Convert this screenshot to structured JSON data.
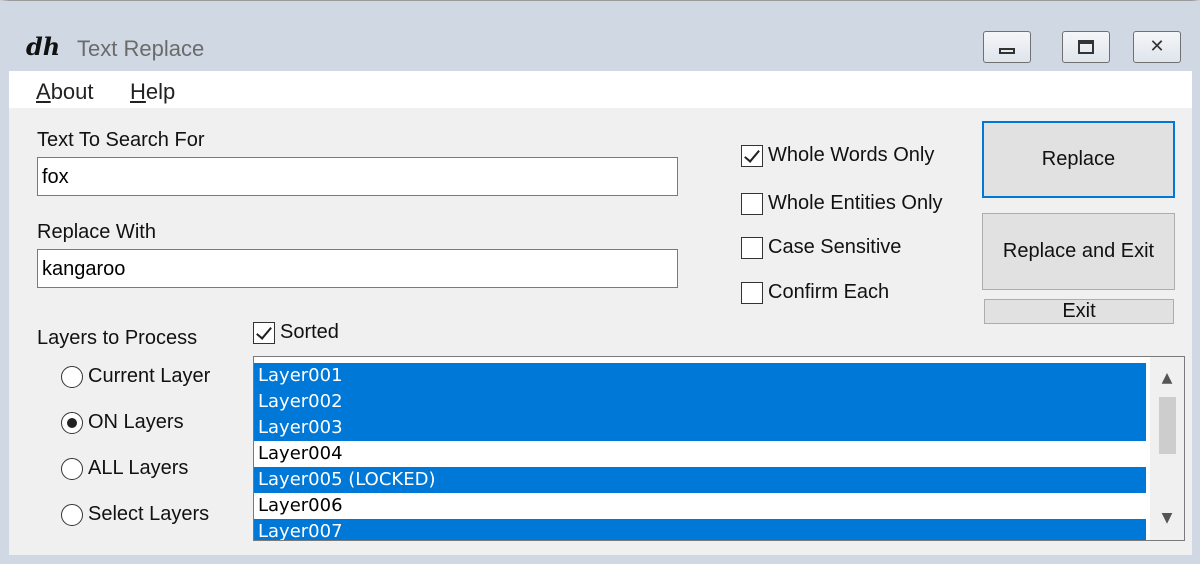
{
  "window": {
    "logo": "dh",
    "title": "Text Replace",
    "controls": {
      "minimize_icon": "minimize-icon",
      "maximize_icon": "maximize-icon",
      "close_icon": "close-icon"
    }
  },
  "menu": {
    "items": [
      {
        "label": "About",
        "accel": "A",
        "rest": "bout"
      },
      {
        "label": "Help",
        "accel": "H",
        "rest": "elp"
      }
    ]
  },
  "search": {
    "label": "Text To Search For",
    "value": "fox"
  },
  "replace": {
    "label": "Replace With",
    "value": "kangaroo"
  },
  "options": [
    {
      "label": "Whole Words Only",
      "checked": true
    },
    {
      "label": "Whole Entities Only",
      "checked": false
    },
    {
      "label": "Case Sensitive",
      "checked": false
    },
    {
      "label": "Confirm Each",
      "checked": false
    }
  ],
  "buttons": {
    "replace": "Replace",
    "replace_exit": "Replace and Exit",
    "exit": "Exit"
  },
  "layers": {
    "label": "Layers to Process",
    "sorted_label": "Sorted",
    "sorted_checked": true,
    "radios": [
      {
        "label": "Current Layer",
        "selected": false
      },
      {
        "label": "ON Layers",
        "selected": true
      },
      {
        "label": "ALL Layers",
        "selected": false
      },
      {
        "label": "Select Layers",
        "selected": false
      }
    ],
    "list": [
      {
        "label": "Layer001",
        "selected": true
      },
      {
        "label": "Layer002",
        "selected": true
      },
      {
        "label": "Layer003",
        "selected": true
      },
      {
        "label": "Layer004",
        "selected": false
      },
      {
        "label": "Layer005 (LOCKED)",
        "selected": true
      },
      {
        "label": "Layer006",
        "selected": false
      },
      {
        "label": "Layer007",
        "selected": true
      }
    ]
  },
  "colors": {
    "selection": "#0078d7",
    "titlebar": "#cfd8e3",
    "face": "#f0f0f0"
  }
}
